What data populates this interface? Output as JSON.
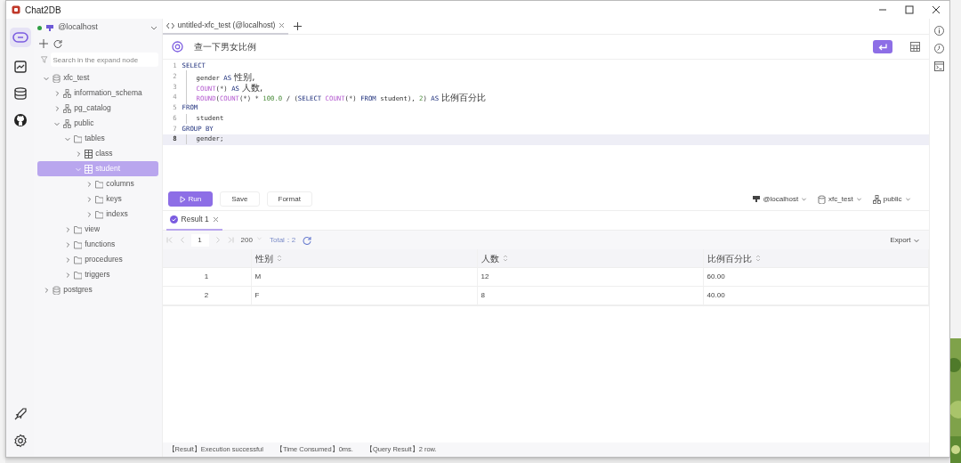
{
  "window": {
    "title": "Chat2DB"
  },
  "sidebar": {
    "connection": "@localhost",
    "connected": true,
    "search": {
      "placeholder": "Search in the expand node"
    },
    "tree": [
      {
        "label": "xfc_test",
        "kind": "database",
        "expanded": true,
        "selected": false,
        "children": [
          {
            "label": "information_schema",
            "kind": "schema",
            "expanded": false,
            "selected": false
          },
          {
            "label": "pg_catalog",
            "kind": "schema",
            "expanded": false,
            "selected": false
          },
          {
            "label": "public",
            "kind": "schema",
            "expanded": true,
            "selected": false,
            "children": [
              {
                "label": "tables",
                "kind": "folder",
                "expanded": true,
                "selected": false,
                "children": [
                  {
                    "label": "class",
                    "kind": "table",
                    "expanded": false,
                    "selected": false
                  },
                  {
                    "label": "student",
                    "kind": "table",
                    "expanded": true,
                    "selected": true,
                    "children": [
                      {
                        "label": "columns",
                        "kind": "folder",
                        "expanded": false,
                        "selected": false
                      },
                      {
                        "label": "keys",
                        "kind": "folder",
                        "expanded": false,
                        "selected": false
                      },
                      {
                        "label": "indexs",
                        "kind": "folder",
                        "expanded": false,
                        "selected": false
                      }
                    ]
                  }
                ]
              },
              {
                "label": "view",
                "kind": "folder",
                "expanded": false,
                "selected": false
              },
              {
                "label": "functions",
                "kind": "folder",
                "expanded": false,
                "selected": false
              },
              {
                "label": "procedures",
                "kind": "folder",
                "expanded": false,
                "selected": false
              },
              {
                "label": "triggers",
                "kind": "folder",
                "expanded": false,
                "selected": false
              }
            ]
          }
        ]
      },
      {
        "label": "postgres",
        "kind": "database",
        "expanded": false,
        "selected": false
      }
    ]
  },
  "tabs": [
    {
      "label": "untitled-xfc_test (@localhost)",
      "selected": true
    }
  ],
  "prompt": {
    "text": "查一下男女比例"
  },
  "editor": {
    "lines": [
      {
        "number": "1",
        "indented": false,
        "current": false,
        "tokens": [
          {
            "kind": "keyword",
            "text": "SELECT"
          }
        ]
      },
      {
        "number": "2",
        "indented": true,
        "current": false,
        "tokens": [
          {
            "kind": "plain",
            "text": "gender "
          },
          {
            "kind": "keyword",
            "text": "AS"
          },
          {
            "kind": "alias",
            "text": " 性别,"
          }
        ]
      },
      {
        "number": "3",
        "indented": true,
        "current": false,
        "tokens": [
          {
            "kind": "function",
            "text": "COUNT"
          },
          {
            "kind": "plain",
            "text": "(*) "
          },
          {
            "kind": "keyword",
            "text": "AS"
          },
          {
            "kind": "alias",
            "text": " 人数,"
          }
        ]
      },
      {
        "number": "4",
        "indented": true,
        "current": false,
        "tokens": [
          {
            "kind": "function",
            "text": "ROUND"
          },
          {
            "kind": "plain",
            "text": "("
          },
          {
            "kind": "function",
            "text": "COUNT"
          },
          {
            "kind": "plain",
            "text": "(*) * "
          },
          {
            "kind": "number",
            "text": "100.0"
          },
          {
            "kind": "plain",
            "text": " / ("
          },
          {
            "kind": "keyword",
            "text": "SELECT "
          },
          {
            "kind": "function",
            "text": "COUNT"
          },
          {
            "kind": "plain",
            "text": "(*) "
          },
          {
            "kind": "keyword",
            "text": "FROM"
          },
          {
            "kind": "plain",
            "text": " student), "
          },
          {
            "kind": "number",
            "text": "2"
          },
          {
            "kind": "plain",
            "text": ") "
          },
          {
            "kind": "keyword",
            "text": "AS"
          },
          {
            "kind": "alias",
            "text": " 比例百分比"
          }
        ]
      },
      {
        "number": "5",
        "indented": false,
        "current": false,
        "tokens": [
          {
            "kind": "keyword",
            "text": "FROM"
          }
        ]
      },
      {
        "number": "6",
        "indented": true,
        "current": false,
        "tokens": [
          {
            "kind": "plain",
            "text": "student"
          }
        ]
      },
      {
        "number": "7",
        "indented": false,
        "current": false,
        "tokens": [
          {
            "kind": "keyword",
            "text": "GROUP BY"
          }
        ]
      },
      {
        "number": "8",
        "indented": true,
        "current": true,
        "tokens": [
          {
            "kind": "plain",
            "text": "gender;"
          }
        ]
      }
    ]
  },
  "actions": [
    "Run",
    "Save",
    "Format"
  ],
  "selectors": [
    {
      "kind": "connection",
      "label": "@localhost"
    },
    {
      "kind": "database",
      "label": "xfc_test"
    },
    {
      "kind": "schema",
      "label": "public"
    }
  ],
  "result_tabs": [
    {
      "label": "Result 1",
      "selected": true
    }
  ],
  "pager": {
    "page": "1",
    "page_size": "200",
    "total": "Total：2",
    "export": "Export"
  },
  "table": {
    "columns": [
      "",
      "性别",
      "人数",
      "比例百分比"
    ],
    "rows": [
      [
        "1",
        "M",
        "12",
        "60.00"
      ],
      [
        "2",
        "F",
        "8",
        "40.00"
      ]
    ]
  },
  "status_bar": [
    "【Result】Execution successful",
    "【Time Consumed】0ms.",
    "【Query Result】2 row."
  ]
}
